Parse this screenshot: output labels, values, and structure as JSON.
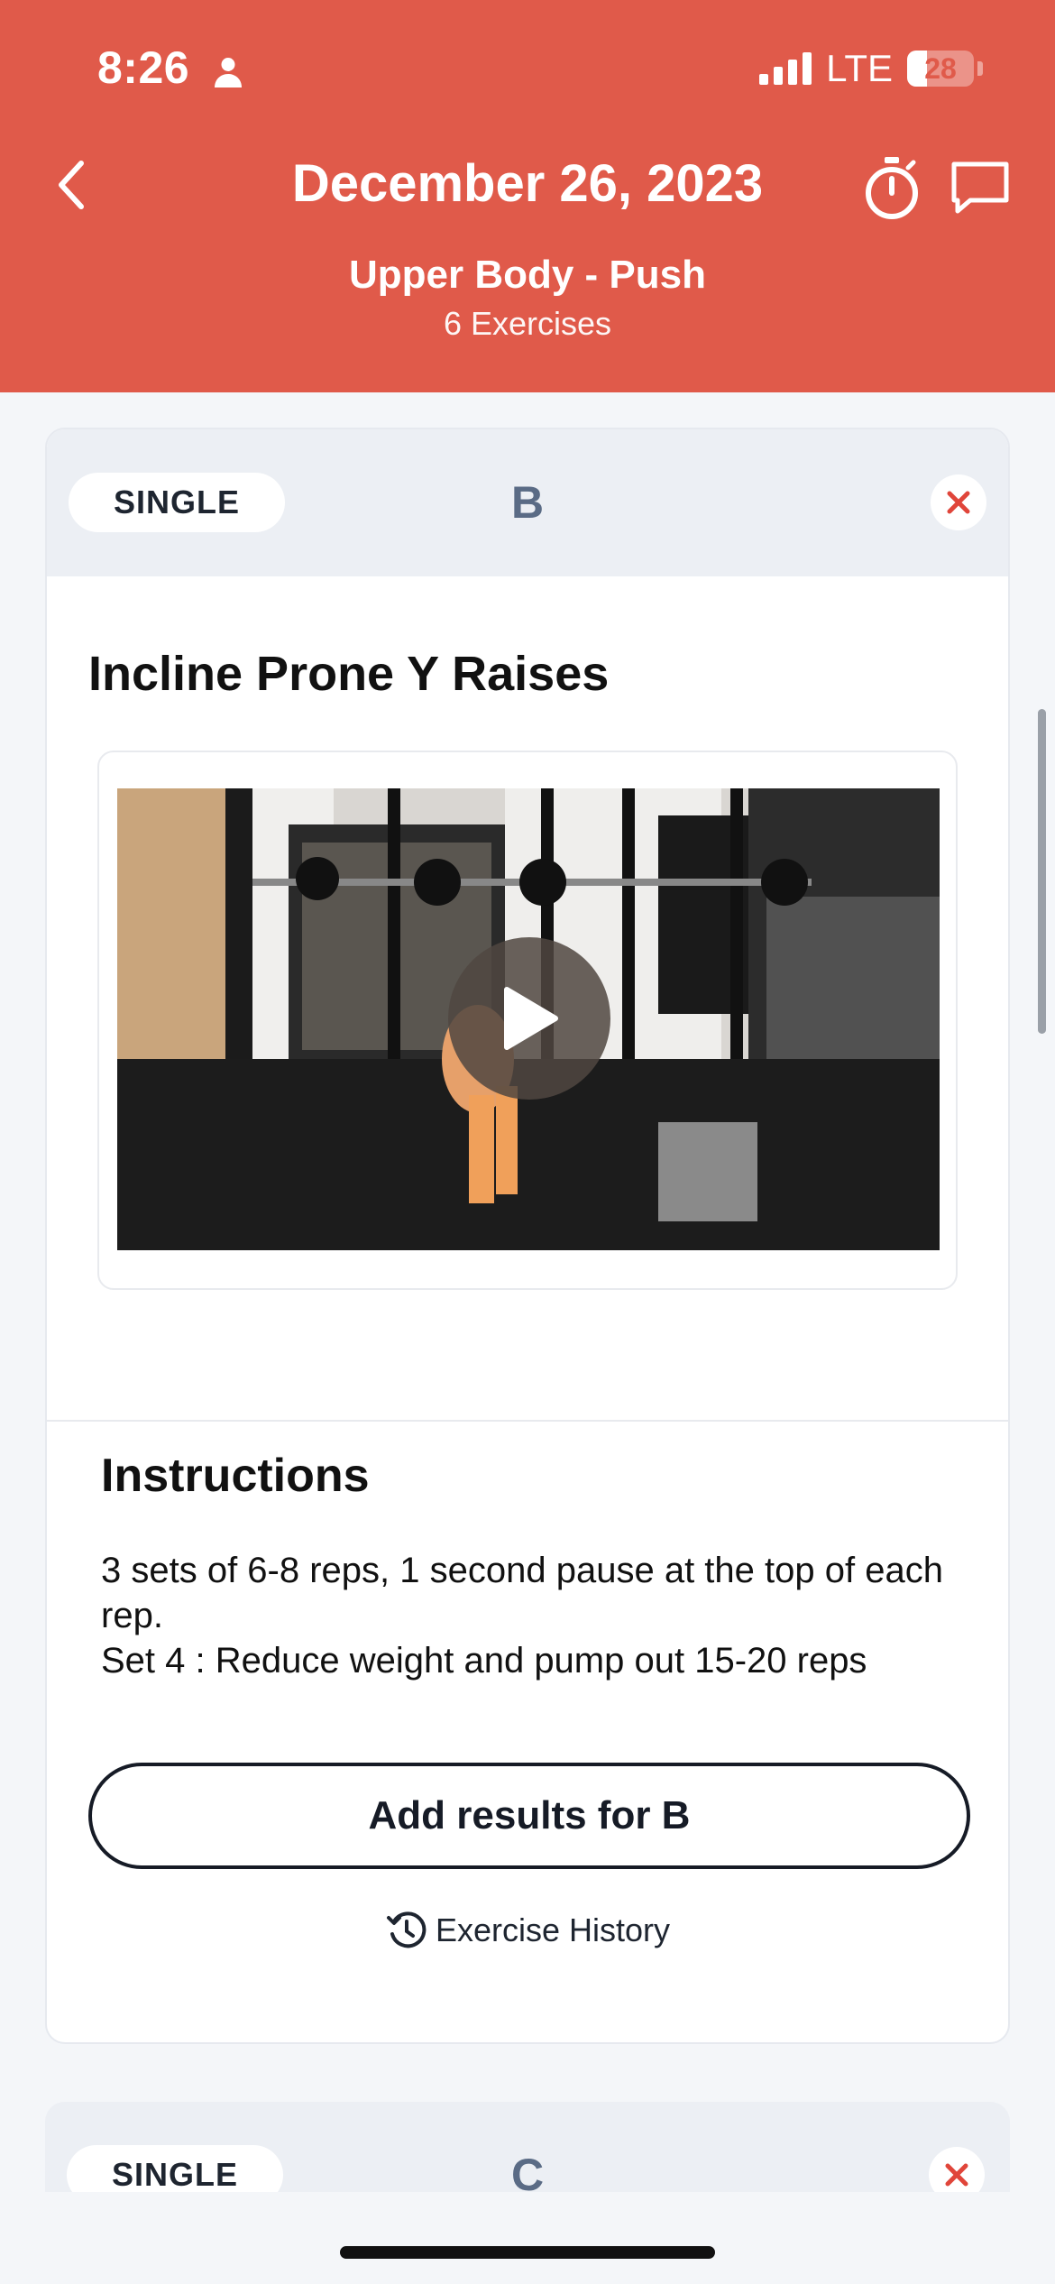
{
  "status_bar": {
    "time": "8:26",
    "network": "LTE",
    "battery": "28"
  },
  "header": {
    "title": "December 26, 2023",
    "subtitle": "Upper Body - Push",
    "exercise_count": "6 Exercises"
  },
  "current_exercise": {
    "type_label": "SINGLE",
    "letter": "B",
    "name": "Incline Prone Y Raises",
    "instructions_heading": "Instructions",
    "instructions_text": "3 sets of 6-8 reps, 1 second pause at the top of each rep.\nSet 4 : Reduce weight and pump out 15-20 reps",
    "add_results_label": "Add results for B",
    "history_label": "Exercise History"
  },
  "next_exercise": {
    "type_label": "SINGLE",
    "letter": "C"
  },
  "colors": {
    "accent": "#e05a4a",
    "close": "#e0453a",
    "dark": "#161b26"
  }
}
